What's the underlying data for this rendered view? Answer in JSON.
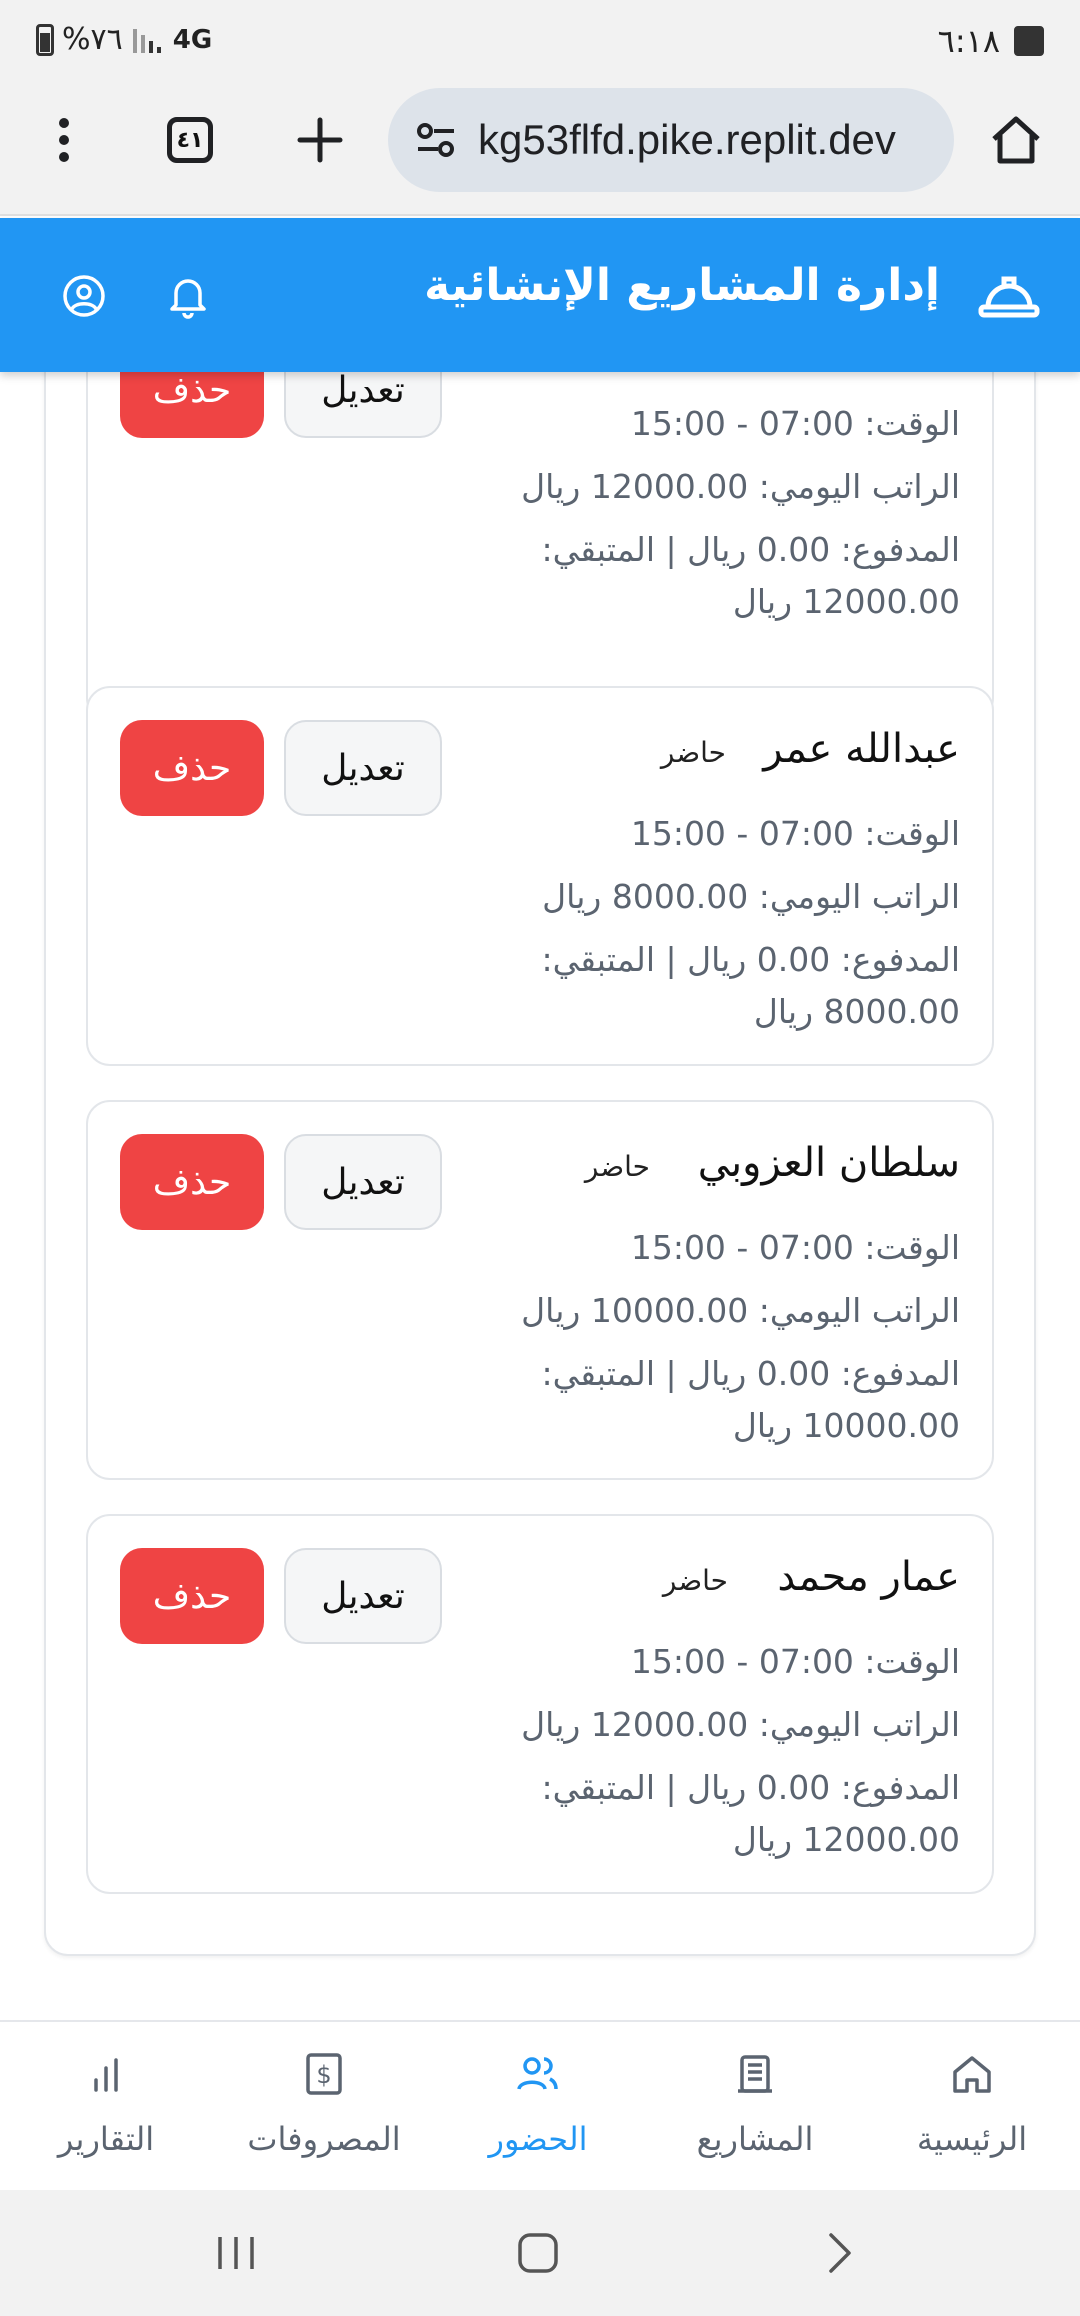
{
  "status_bar": {
    "time": "٦:١٨",
    "battery": "%٧٦",
    "network": "4G"
  },
  "browser": {
    "url": "kg53flfd.pike.replit.dev",
    "tab_count": "٤١"
  },
  "app": {
    "title": "إدارة المشاريع الإنشائية",
    "accent_color": "#2196f3",
    "delete_color": "#ef4444"
  },
  "partial_card": {
    "time": "الوقت: 07:00 - 15:00",
    "daily_wage": "الراتب اليومي: 12000.00 ريال",
    "paid_line1": "المدفوع: 0.00 ريال | المتبقي:",
    "paid_line2": "12000.00 ريال"
  },
  "workers": [
    {
      "name": "عبدالله عمر",
      "status": "حاضر",
      "time": "الوقت: 07:00 - 15:00",
      "daily_wage": "الراتب اليومي: 8000.00 ريال",
      "paid_line1": "المدفوع: 0.00 ريال | المتبقي:",
      "paid_line2": "8000.00 ريال"
    },
    {
      "name": "سلطان العزوبي",
      "status": "حاضر",
      "time": "الوقت: 07:00 - 15:00",
      "daily_wage": "الراتب اليومي: 10000.00 ريال",
      "paid_line1": "المدفوع: 0.00 ريال | المتبقي:",
      "paid_line2": "10000.00 ريال"
    },
    {
      "name": "عمار محمد",
      "status": "حاضر",
      "time": "الوقت: 07:00 - 15:00",
      "daily_wage": "الراتب اليومي: 12000.00 ريال",
      "paid_line1": "المدفوع: 0.00 ريال | المتبقي:",
      "paid_line2": "12000.00 ريال"
    }
  ],
  "buttons": {
    "edit": "تعديل",
    "delete": "حذف"
  },
  "nav": {
    "home": "الرئيسية",
    "projects": "المشاريع",
    "attendance": "الحضور",
    "expenses": "المصروفات",
    "reports": "التقارير",
    "active": "attendance"
  }
}
